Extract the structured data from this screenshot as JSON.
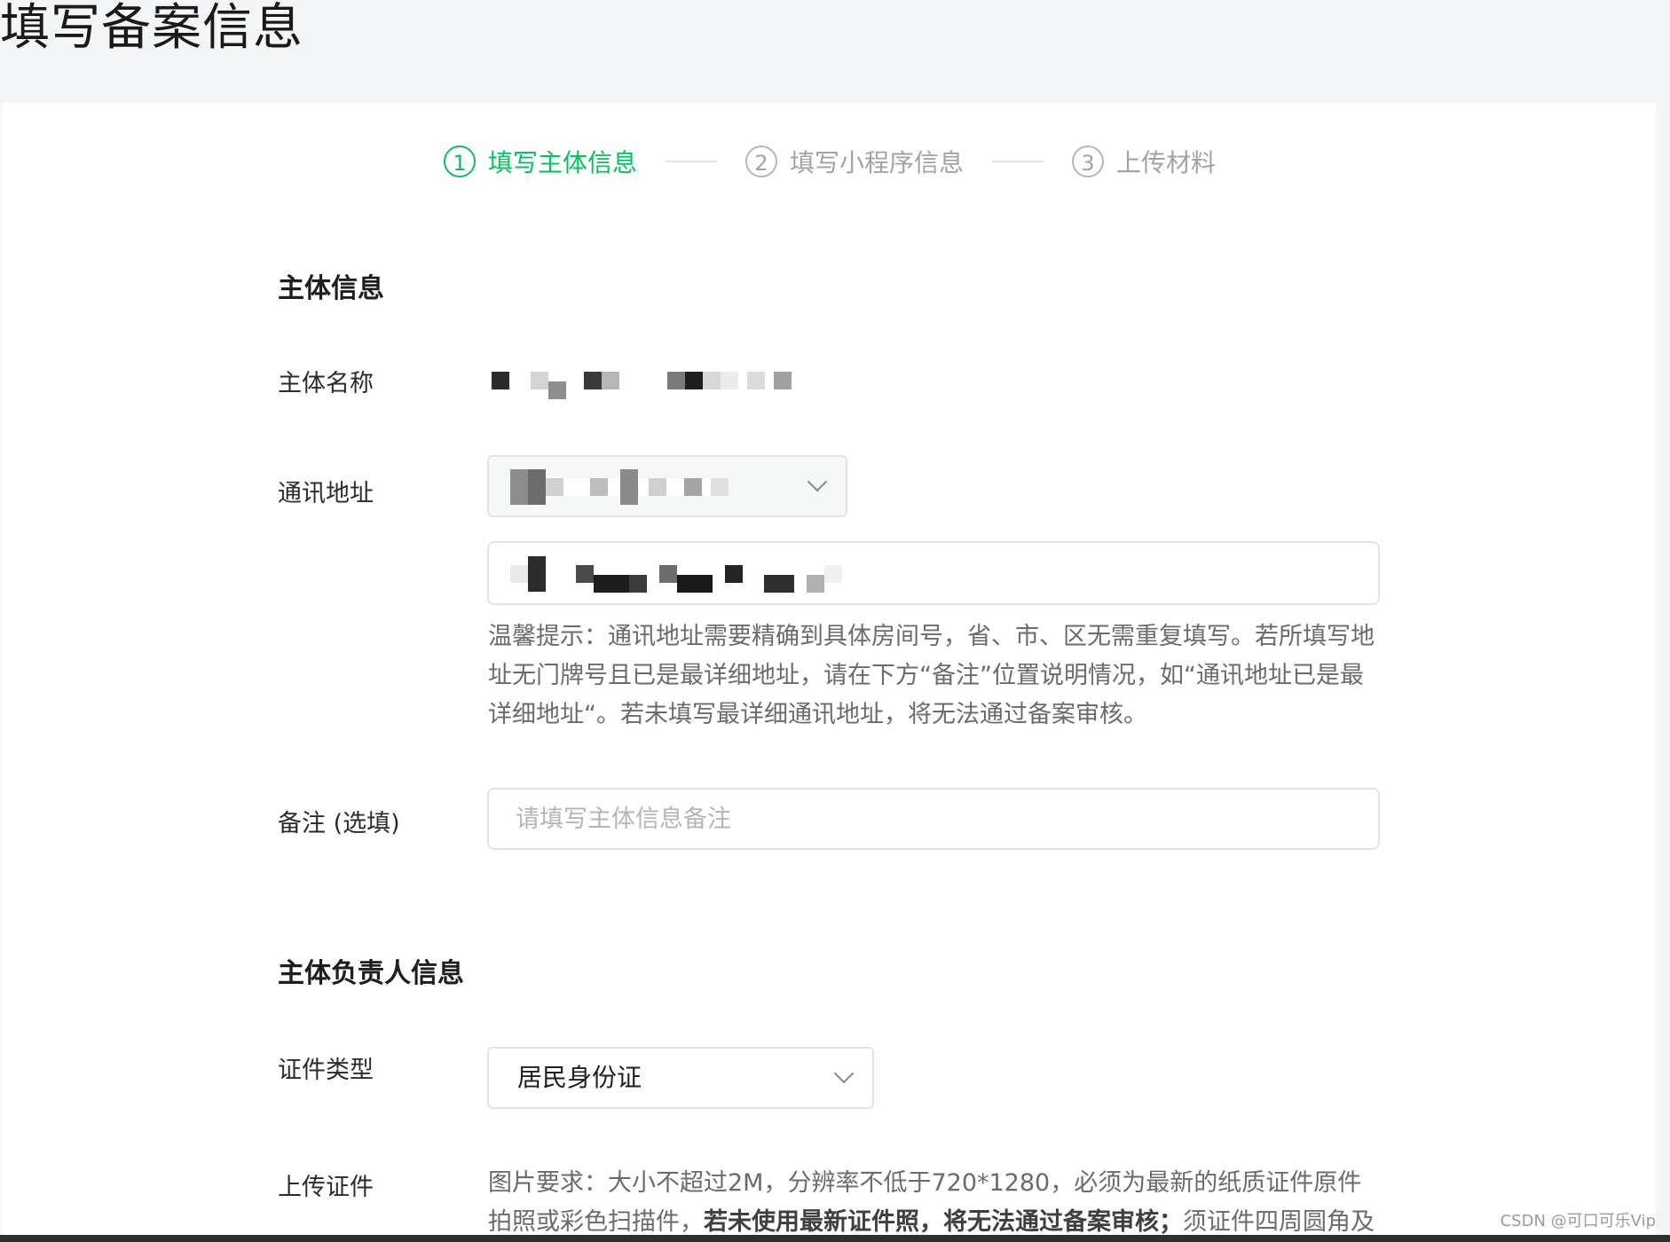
{
  "page": {
    "title": "填写备案信息"
  },
  "steps": [
    {
      "number": "1",
      "label": "填写主体信息",
      "active": true
    },
    {
      "number": "2",
      "label": "填写小程序信息",
      "active": false
    },
    {
      "number": "3",
      "label": "上传材料",
      "active": false
    }
  ],
  "subject_info": {
    "section_title": "主体信息",
    "name_label": "主体名称",
    "address_label": "通讯地址",
    "address_hint": "温馨提示：通讯地址需要精确到具体房间号，省、市、区无需重复填写。若所填写地址无门牌号且已是最详细地址，请在下方“备注”位置说明情况，如“通讯地址已是最详细地址“。若未填写最详细通讯地址，将无法通过备案审核。",
    "remark_label": "备注 (选填)",
    "remark_placeholder": "请填写主体信息备注"
  },
  "responsible_person": {
    "section_title": "主体负责人信息",
    "id_type_label": "证件类型",
    "id_type_value": "居民身份证",
    "upload_label": "上传证件",
    "upload_hint_part1": "图片要求：大小不超过2M，分辨率不低于720*1280，必须为最新的纸质证件原件拍照或彩色扫描件，",
    "upload_hint_bold": "若未使用最新证件照，将无法通过备案审核；",
    "upload_hint_part2": "须证件四周圆角及卡"
  },
  "watermark": "CSDN @可口可乐Vip",
  "icons": {
    "select_arrow": "chevron-down-icon"
  },
  "colors": {
    "accent": "#07c160",
    "inactive": "#a3a3a3"
  }
}
